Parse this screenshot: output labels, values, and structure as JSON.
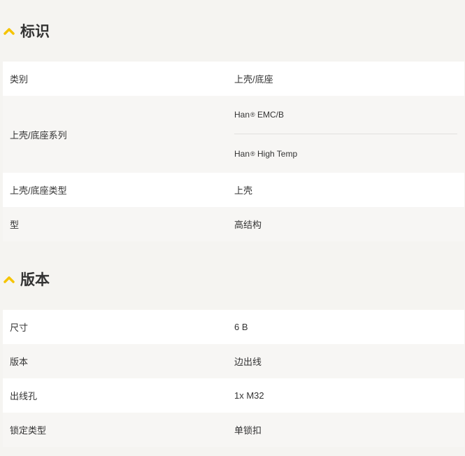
{
  "colors": {
    "accent": "#f5c400",
    "background": "#f5f4f1"
  },
  "sections": [
    {
      "title": "标识",
      "icon": "chevron-up-icon",
      "rows": [
        {
          "label": "类别",
          "value": "上壳/底座"
        },
        {
          "label": "上壳/底座系列",
          "values": [
            "Han",
            "EMC/B",
            "Han",
            "High Temp"
          ]
        },
        {
          "label": "上壳/底座类型",
          "value": "上壳"
        },
        {
          "label": "型",
          "value": "高结构"
        }
      ]
    },
    {
      "title": "版本",
      "icon": "chevron-up-icon",
      "rows": [
        {
          "label": "尺寸",
          "value": "6 B"
        },
        {
          "label": "版本",
          "value": "边出线"
        },
        {
          "label": "出线孔",
          "value": "1x M32"
        },
        {
          "label": "锁定类型",
          "value": "单锁扣"
        }
      ]
    }
  ],
  "registered_mark": "®"
}
